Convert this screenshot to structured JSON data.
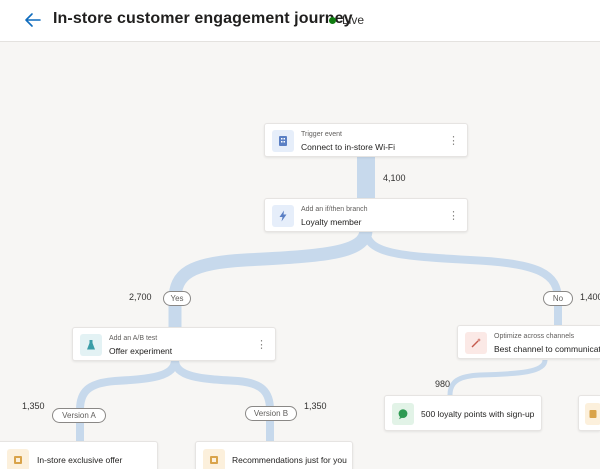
{
  "header": {
    "title": "In-store customer engagement journey",
    "status": "Live"
  },
  "colors": {
    "flow": "#c7d9ec",
    "status_live": "#107c10",
    "icon_blue": "#5a7fc4",
    "icon_teal": "#3a9da7",
    "icon_orange": "#d9a34a",
    "icon_red": "#c65a4d",
    "icon_green": "#2e9a52"
  },
  "nodes": {
    "trigger": {
      "subtitle": "Trigger event",
      "title": "Connect to in-store Wi-Fi",
      "icon": "building-icon"
    },
    "branch": {
      "subtitle": "Add an if/then branch",
      "title": "Loyalty member",
      "icon": "lightning-icon"
    },
    "abtest": {
      "subtitle": "Add an A/B test",
      "title": "Offer experiment",
      "icon": "flask-icon"
    },
    "optimize": {
      "subtitle": "Optimize across channels",
      "title": "Best channel to communicate",
      "icon": "wand-icon"
    },
    "loyalty_message": {
      "title": "500 loyalty points with sign-up",
      "icon": "chat-icon"
    },
    "exclusive_offer": {
      "title": "In-store exclusive offer",
      "icon": "box-icon"
    },
    "recommendations": {
      "title": "Recommendations just for you",
      "icon": "box-icon"
    }
  },
  "counts": {
    "trigger_to_branch": "4,100",
    "yes_branch": "2,700",
    "no_branch": "1,400",
    "version_a": "1,350",
    "version_b": "1,350",
    "loyalty_message": "980"
  },
  "labels": {
    "yes": "Yes",
    "no": "No",
    "version_a": "Version A",
    "version_b": "Version B"
  },
  "more_glyph": "⋮"
}
